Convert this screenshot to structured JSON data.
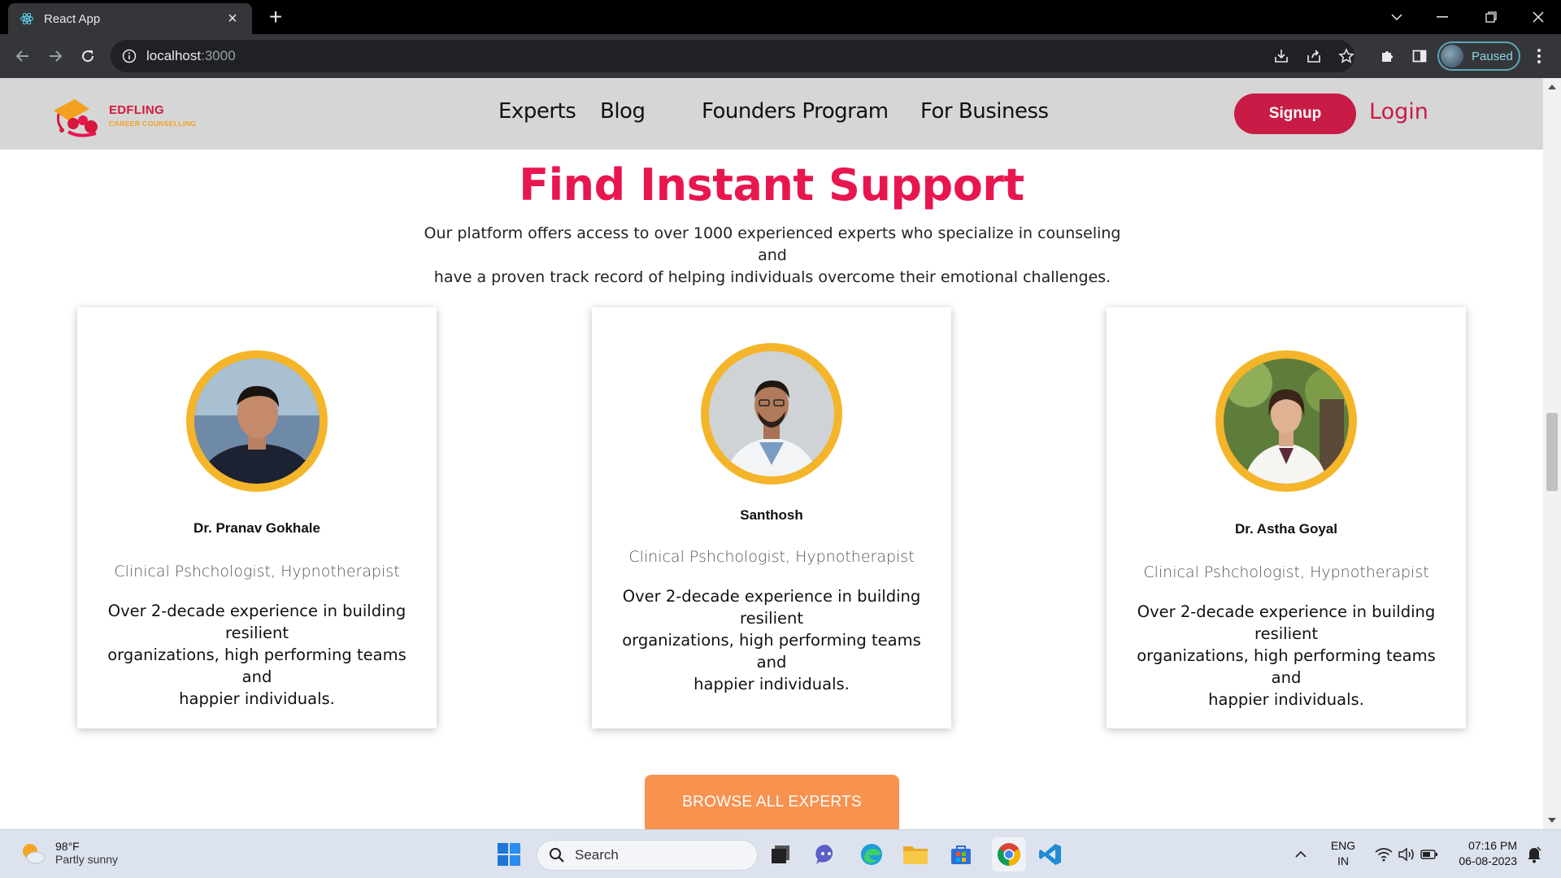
{
  "browser": {
    "tab_title": "React App",
    "url_host": "localhost",
    "url_port": ":3000",
    "profile_status": "Paused"
  },
  "header": {
    "brand_name": "EDFLING",
    "brand_tagline": "CAREER COUNSELLING",
    "nav": [
      "Experts",
      "Blog",
      "Founders Program",
      "For Business"
    ],
    "signup_label": "Signup",
    "login_label": "Login"
  },
  "section": {
    "title": "Find Instant Support",
    "description_line1": "Our platform offers access to over 1000 experienced experts who specialize in counseling and",
    "description_line2": "have a proven track record of helping individuals overcome their emotional challenges."
  },
  "experts": [
    {
      "name": "Dr. Pranav Gokhale",
      "role": "Clinical Pshchologist, Hypnotherapist",
      "bio_line1": "Over 2-decade experience in building resilient",
      "bio_line2": "organizations, high performing teams and",
      "bio_line3": "happier individuals."
    },
    {
      "name": "Santhosh",
      "role": "Clinical Pshchologist, Hypnotherapist",
      "bio_line1": "Over 2-decade experience in building resilient",
      "bio_line2": "organizations, high performing teams and",
      "bio_line3": "happier individuals."
    },
    {
      "name": "Dr. Astha Goyal",
      "role": "Clinical Pshchologist, Hypnotherapist",
      "bio_line1": "Over 2-decade experience in building resilient",
      "bio_line2": "organizations, high performing teams and",
      "bio_line3": "happier individuals."
    }
  ],
  "browse_button_label": "BROWSE ALL EXPERTS",
  "taskbar": {
    "weather_temp": "98°F",
    "weather_condition": "Partly sunny",
    "search_placeholder": "Search",
    "lang_line1": "ENG",
    "lang_line2": "IN",
    "time": "07:16 PM",
    "date": "06-08-2023"
  },
  "colors": {
    "brand_red": "#c81b45",
    "title_pink": "#e8164f",
    "photo_ring": "#f4b52a",
    "browse_orange": "#f8924f",
    "header_gray": "#d6d6d6"
  },
  "icons": [
    "react-icon",
    "info-icon",
    "install-icon",
    "share-icon",
    "star-icon",
    "extensions-icon",
    "sidepanel-icon",
    "menu-icon",
    "weather-icon",
    "windows-start-icon",
    "search-icon",
    "task-view-icon",
    "teams-icon",
    "edge-icon",
    "file-explorer-icon",
    "store-icon",
    "chrome-icon",
    "vscode-icon",
    "wifi-icon",
    "volume-icon",
    "battery-icon",
    "notification-icon"
  ]
}
